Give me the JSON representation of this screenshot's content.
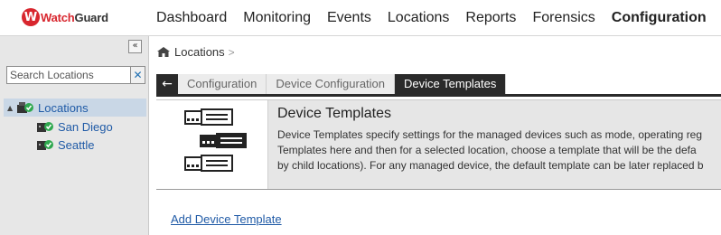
{
  "brand": {
    "logo_letter": "W",
    "logo_text_primary": "Watch",
    "logo_text_secondary": "Guard"
  },
  "nav": {
    "items": [
      {
        "label": "Dashboard"
      },
      {
        "label": "Monitoring"
      },
      {
        "label": "Events"
      },
      {
        "label": "Locations"
      },
      {
        "label": "Reports"
      },
      {
        "label": "Forensics"
      },
      {
        "label": "Configuration",
        "active": true
      }
    ]
  },
  "sidebar": {
    "collapse_label": "«",
    "search": {
      "placeholder": "Search Locations",
      "value": "",
      "clear_label": "✕"
    },
    "tree": {
      "root": {
        "label": "Locations",
        "toggle": "▲"
      },
      "children": [
        {
          "label": "San Diego"
        },
        {
          "label": "Seattle"
        }
      ]
    }
  },
  "breadcrumb": {
    "label": "Locations",
    "separator": ">"
  },
  "tabs": {
    "back_label": "←",
    "items": [
      {
        "label": "Configuration"
      },
      {
        "label": "Device Configuration"
      },
      {
        "label": "Device Templates",
        "active": true
      }
    ]
  },
  "info": {
    "title": "Device Templates",
    "lines": [
      "Device Templates specify settings for the managed devices such as mode, operating reg",
      "Templates here and then for a selected location, choose a template that will be the defa",
      "by child locations). For any managed device, the default template can be later replaced b"
    ]
  },
  "actions": {
    "add_template_label": "Add Device Template"
  },
  "colors": {
    "brand_red": "#d8262e",
    "link_blue": "#1f5aa6",
    "status_green": "#2fa84f",
    "tab_dark": "#2a2a2a"
  }
}
